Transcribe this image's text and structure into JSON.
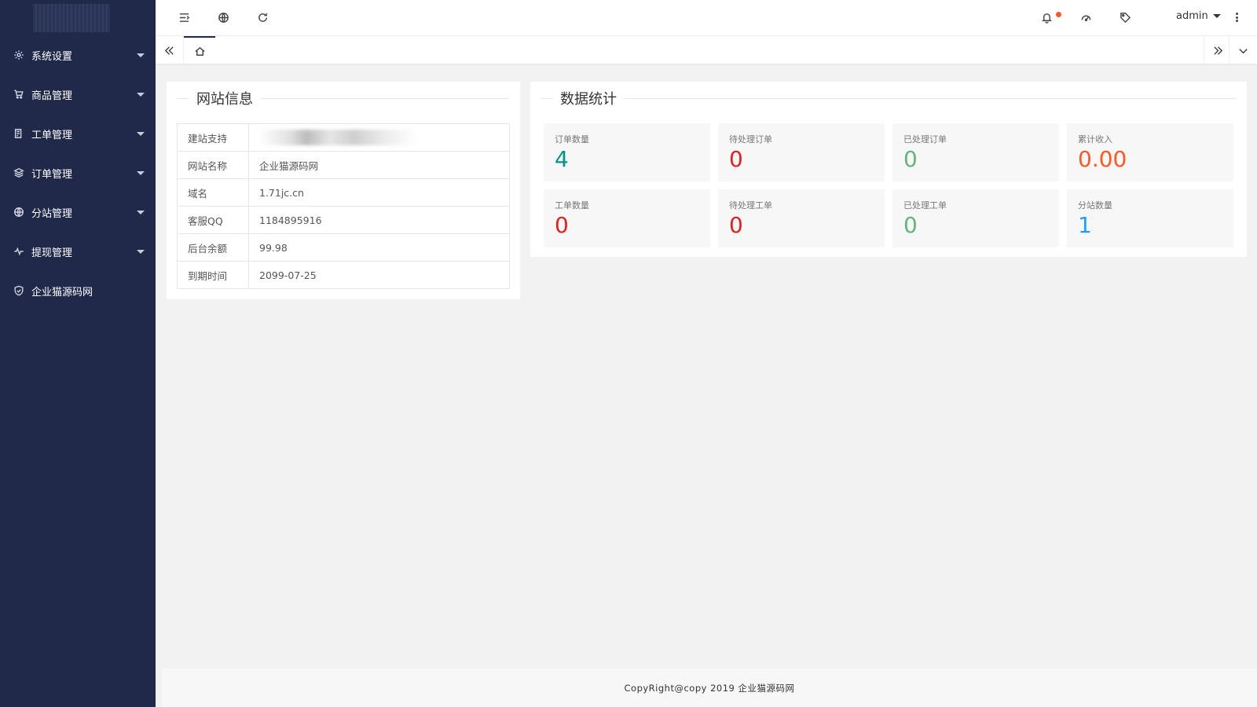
{
  "sidebar": {
    "items": [
      {
        "label": "系统设置",
        "icon": "gear-icon",
        "has_caret": true
      },
      {
        "label": "商品管理",
        "icon": "cart-icon",
        "has_caret": true
      },
      {
        "label": "工单管理",
        "icon": "ticket-icon",
        "has_caret": true
      },
      {
        "label": "订单管理",
        "icon": "layers-icon",
        "has_caret": true
      },
      {
        "label": "分站管理",
        "icon": "globe-icon",
        "has_caret": true
      },
      {
        "label": "提现管理",
        "icon": "pulse-icon",
        "has_caret": true
      },
      {
        "label": "企业猫源码网",
        "icon": "shield-icon",
        "has_caret": false
      }
    ]
  },
  "header": {
    "user": "admin",
    "icons": [
      "menu-toggle-icon",
      "globe-icon",
      "refresh-icon",
      "bell-icon",
      "dashboard-icon",
      "tag-icon",
      "more-vertical-icon"
    ],
    "notification_dot_color": "#ff5722"
  },
  "tabbar": {
    "home_icon": "home-icon"
  },
  "site_info": {
    "title": "网站信息",
    "rows": [
      {
        "key": "建站支持",
        "value": ""
      },
      {
        "key": "网站名称",
        "value": "企业猫源码网"
      },
      {
        "key": "域名",
        "value": "1.71jc.cn"
      },
      {
        "key": "客服QQ",
        "value": "1184895916"
      },
      {
        "key": "后台余额",
        "value": "99.98"
      },
      {
        "key": "到期时间",
        "value": "2099-07-25"
      }
    ]
  },
  "stats": {
    "title": "数据统计",
    "cards": [
      {
        "label": "订单数量",
        "value": "4",
        "color": "#009688"
      },
      {
        "label": "待处理订单",
        "value": "0",
        "color": "#e62020"
      },
      {
        "label": "已处理订单",
        "value": "0",
        "color": "#5fb878"
      },
      {
        "label": "累计收入",
        "value": "0.00",
        "color": "#ff5722"
      },
      {
        "label": "工单数量",
        "value": "0",
        "color": "#e62020"
      },
      {
        "label": "待处理工单",
        "value": "0",
        "color": "#e62020"
      },
      {
        "label": "已处理工单",
        "value": "0",
        "color": "#5fb878"
      },
      {
        "label": "分站数量",
        "value": "1",
        "color": "#1e9fff"
      }
    ]
  },
  "footer": {
    "text": "CopyRight@copy 2019 企业猫源码网"
  },
  "colors": {
    "sidebar_bg": "#20294a",
    "page_bg": "#f2f2f2"
  }
}
